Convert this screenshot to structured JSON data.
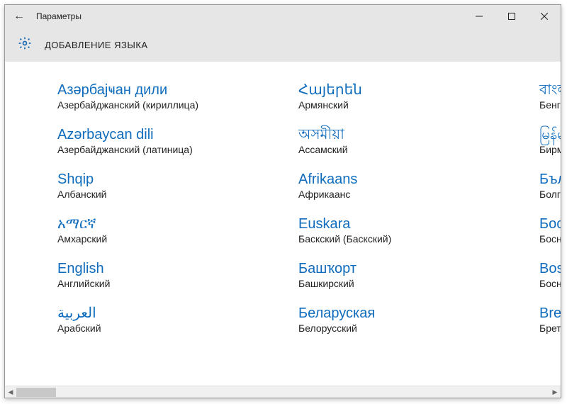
{
  "titlebar": {
    "app_title": "Параметры",
    "back_glyph": "←"
  },
  "header": {
    "title": "ДОБАВЛЕНИЕ ЯЗЫКА"
  },
  "columns": [
    [
      {
        "native": "Азәрбајҹан дили",
        "local": "Азербайджанский (кириллица)"
      },
      {
        "native": "Azərbaycan dili",
        "local": "Азербайджанский (латиница)"
      },
      {
        "native": "Shqip",
        "local": "Албанский"
      },
      {
        "native": "አማርኛ",
        "local": "Амхарский"
      },
      {
        "native": "English",
        "local": "Английский"
      },
      {
        "native": "العربية",
        "local": "Арабский"
      }
    ],
    [
      {
        "native": "Հայերեն",
        "local": "Армянский"
      },
      {
        "native": "অসমীয়া",
        "local": "Ассамский"
      },
      {
        "native": "Afrikaans",
        "local": "Африкаанс"
      },
      {
        "native": "Euskara",
        "local": "Баскский (Баскский)"
      },
      {
        "native": "Башҡорт",
        "local": "Башкирский"
      },
      {
        "native": "Беларуская",
        "local": "Белорусский"
      }
    ],
    [
      {
        "native": "বাংলা",
        "local": "Бенгальск"
      },
      {
        "native": "မြန်မာ",
        "local": "Бирманск"
      },
      {
        "native": "Българ",
        "local": "Болгарски"
      },
      {
        "native": "Босанс",
        "local": "Боснийск"
      },
      {
        "native": "Bosansk",
        "local": "Боснийск"
      },
      {
        "native": "Brezhon",
        "local": "Бретонск"
      }
    ]
  ]
}
